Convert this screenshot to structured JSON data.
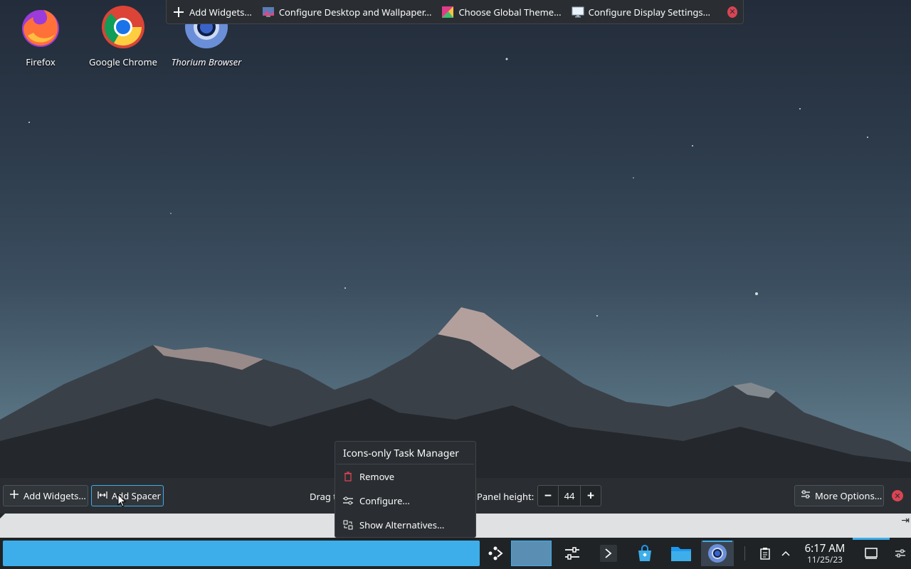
{
  "desktop_icons": [
    {
      "label": "Firefox",
      "icon": "firefox-icon"
    },
    {
      "label": "Google Chrome",
      "icon": "chrome-icon"
    },
    {
      "label": "Thorium Browser",
      "icon": "thorium-icon"
    }
  ],
  "top_toolbar": {
    "add_widgets": "Add Widgets...",
    "configure_desktop": "Configure Desktop and Wallpaper...",
    "global_theme": "Choose Global Theme...",
    "display_settings": "Configure Display Settings..."
  },
  "panel_edit": {
    "add_widgets": "Add Widgets...",
    "add_spacer": "Add Spacer",
    "drag_text": "Drag t",
    "panel_height_label": "Panel height:",
    "panel_height_value": "44",
    "more_options": "More Options..."
  },
  "context_menu": {
    "title": "Icons-only Task Manager",
    "items": [
      {
        "label": "Remove",
        "icon": "trash-icon"
      },
      {
        "label": "Configure...",
        "icon": "configure-icon"
      },
      {
        "label": "Show Alternatives...",
        "icon": "alternatives-icon"
      }
    ]
  },
  "taskbar": {
    "tasks": [
      "kde-connect-icon",
      "placeholder",
      "settings-icon",
      "konsole-icon",
      "discover-icon",
      "dolphin-icon",
      "chromium-icon"
    ],
    "tray": [
      "clipboard-icon",
      "expand-tray-icon",
      "show-desktop-icon",
      "panel-config-icon"
    ],
    "clock_time": "6:17 AM",
    "clock_date": "11/25/23"
  },
  "colors": {
    "accent": "#3daee9",
    "panel_bg": "#202326",
    "toolbar_bg": "#2a2e32",
    "close_red": "#da4453"
  }
}
